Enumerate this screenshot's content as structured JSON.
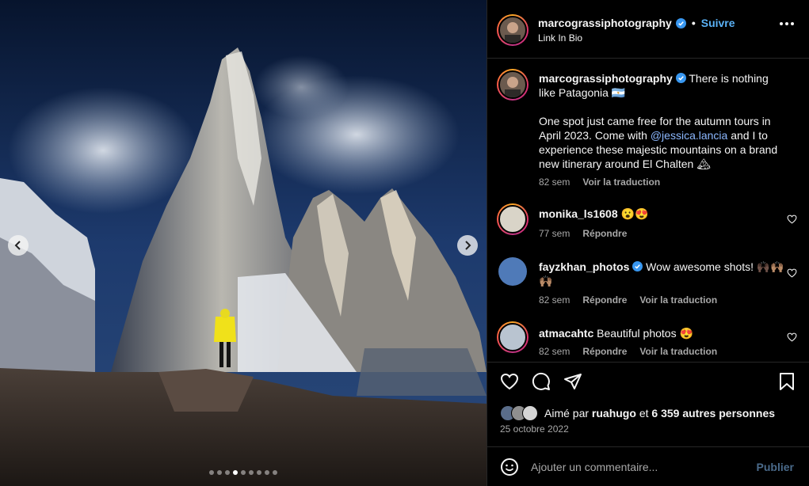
{
  "post": {
    "author": "marcograssiphotography",
    "follow_label": "Suivre",
    "separator": "•",
    "subtitle": "Link In Bio",
    "carousel_count": 9,
    "carousel_active": 3
  },
  "caption": {
    "username": "marcograssiphotography",
    "line1": "There is nothing like Patagonia 🇦🇷",
    "line2_before": "One spot just came free for the autumn tours in April 2023. Come with ",
    "mention": "@jessica.lancia",
    "line2_after": " and I to experience these majestic mountains on a brand new itinerary around El Chalten 🏔",
    "time": "82 sem",
    "translate": "Voir la traduction"
  },
  "comments": [
    {
      "username": "monika_ls1608",
      "text": "😮😍",
      "time": "77 sem",
      "reply": "Répondre",
      "translate": ""
    },
    {
      "username": "fayzkhan_photos",
      "text": "Wow awesome shots! 🙌🏿🙌🏽🙌🏽",
      "time": "82 sem",
      "reply": "Répondre",
      "translate": "Voir la traduction"
    },
    {
      "username": "atmacahtc",
      "text": "Beautiful photos 😍",
      "time": "82 sem",
      "reply": "Répondre",
      "translate": "Voir la traduction"
    }
  ],
  "likes": {
    "prefix": "Aimé par",
    "user": "ruahugo",
    "joiner": "et",
    "others": "6 359 autres personnes"
  },
  "date": "25 octobre 2022",
  "composer": {
    "placeholder": "Ajouter un commentaire...",
    "publish_label": "Publier"
  },
  "icons": [
    "chevron-left-icon",
    "chevron-right-icon",
    "verified-badge-icon",
    "more-icon",
    "heart-icon",
    "comment-icon",
    "share-icon",
    "bookmark-icon",
    "emoji-icon"
  ],
  "colors": {
    "accent": "#5ab1f5",
    "mention": "#8cb8ff",
    "muted": "#a8a8a8",
    "background": "#000000"
  }
}
